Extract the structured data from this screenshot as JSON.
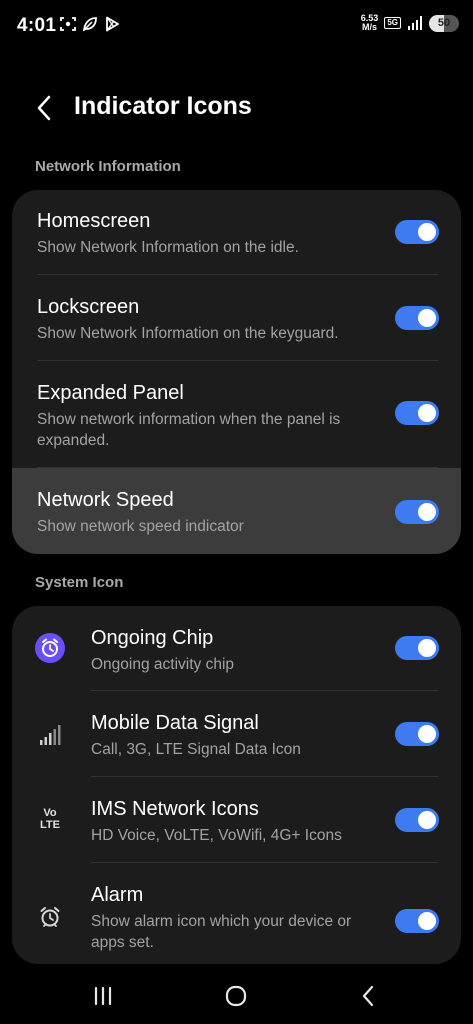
{
  "status_bar": {
    "time": "4:01",
    "speed_value": "6.53",
    "speed_unit": "M/s",
    "network_type": "5G",
    "battery_level": "50"
  },
  "header": {
    "title": "Indicator Icons"
  },
  "sections": [
    {
      "label": "Network Information",
      "items": [
        {
          "title": "Homescreen",
          "subtitle": "Show Network Information on the idle.",
          "enabled": true
        },
        {
          "title": "Lockscreen",
          "subtitle": "Show Network Information on the keyguard.",
          "enabled": true
        },
        {
          "title": "Expanded Panel",
          "subtitle_line1": "Show network information when the panel is",
          "subtitle_line2": "expanded.",
          "enabled": true
        },
        {
          "title": "Network Speed",
          "subtitle": "Show network speed indicator",
          "enabled": true
        }
      ]
    },
    {
      "label": "System Icon",
      "items": [
        {
          "title": "Ongoing Chip",
          "subtitle": "Ongoing activity chip",
          "icon": "alarm-clock-chip-icon",
          "enabled": true
        },
        {
          "title": "Mobile Data Signal",
          "subtitle": "Call, 3G, LTE Signal Data Icon",
          "icon": "signal-bars-icon",
          "enabled": true
        },
        {
          "title": "IMS Network Icons",
          "subtitle": "HD Voice, VoLTE, VoWifi, 4G+ Icons",
          "icon": "volte-icon",
          "icon_text_top": "Vo",
          "icon_text_bottom": "LTE",
          "enabled": true
        },
        {
          "title": "Alarm",
          "subtitle_line1": "Show alarm icon which your device or",
          "subtitle_line2": "apps set.",
          "icon": "alarm-icon",
          "enabled": true
        }
      ]
    }
  ],
  "colors": {
    "toggle_on": "#3e7af0",
    "chip_icon": "#6b4ff5"
  }
}
